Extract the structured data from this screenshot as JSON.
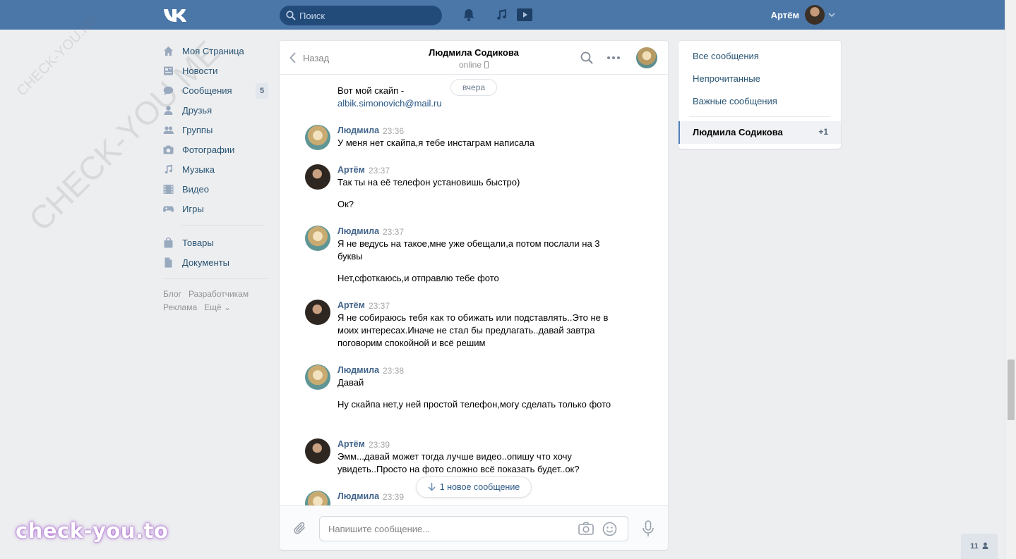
{
  "header": {
    "search_placeholder": "Поиск",
    "user_name": "Артём"
  },
  "sidebar": {
    "items": [
      {
        "label": "Моя Страница",
        "icon": "home-icon"
      },
      {
        "label": "Новости",
        "icon": "news-icon"
      },
      {
        "label": "Сообщения",
        "icon": "messages-icon",
        "badge": "5"
      },
      {
        "label": "Друзья",
        "icon": "friends-icon"
      },
      {
        "label": "Группы",
        "icon": "groups-icon"
      },
      {
        "label": "Фотографии",
        "icon": "camera-icon"
      },
      {
        "label": "Музыка",
        "icon": "music-icon"
      },
      {
        "label": "Видео",
        "icon": "video-icon"
      },
      {
        "label": "Игры",
        "icon": "gamepad-icon"
      }
    ],
    "items2": [
      {
        "label": "Товары",
        "icon": "bag-icon"
      },
      {
        "label": "Документы",
        "icon": "document-icon"
      }
    ],
    "footer": [
      "Блог",
      "Разработчикам",
      "Реклама",
      "Ещё ⌄"
    ]
  },
  "chat": {
    "back_label": "Назад",
    "peer_name": "Людмила Содикова",
    "peer_status": "online",
    "date_separator": "вчера",
    "new_messages_label": "1 новое сообщение",
    "input_placeholder": "Напишите сообщение...",
    "messages": [
      {
        "text_prefix": "Вот мой скайп -",
        "link": "albik.simonovich@mail.ru"
      },
      {
        "author": "Людмила",
        "time": "23:36",
        "text": "У меня нет скайпа,я тебе инстаграм написала"
      },
      {
        "author": "Артём",
        "time": "23:37",
        "text": "Так ты на её телефон установишь быстро)"
      },
      {
        "text": "Ок?"
      },
      {
        "author": "Людмила",
        "time": "23:37",
        "text": "Я не ведусь на такое,мне уже обещали,а потом послали на 3 буквы"
      },
      {
        "text": "Нет,сфоткаюсь,и отправлю тебе фото"
      },
      {
        "author": "Артём",
        "time": "23:37",
        "text": "Я не собираюсь тебя как то обижать или подставлять..Это не в моих интересах.Иначе не стал бы предлагать..давай завтра поговорим спокойной и всё решим"
      },
      {
        "author": "Людмила",
        "time": "23:38",
        "text": "Давай"
      },
      {
        "text": "Ну скайпа нет,у ней простой телефон,могу сделать только фото"
      },
      {
        "author": "Артём",
        "time": "23:39",
        "text": "Эмм...давай может тогда лучше видео..опишу что хочу увидеть..Просто на фото сложно всё показать будет..ок?"
      },
      {
        "author": "Людмила",
        "time": "23:39"
      }
    ]
  },
  "right_panel": {
    "filters": [
      "Все сообщения",
      "Непрочитанные",
      "Важные сообщения"
    ],
    "active_dialog": {
      "name": "Людмила Содикова",
      "count": "+1"
    }
  },
  "online_friends_count": "11",
  "watermarks": {
    "diagonal": "CHECK-YOU.ME",
    "brand": "check-you.to"
  },
  "colors": {
    "header_bg": "#4a76a8",
    "page_bg": "#edeef0",
    "link": "#2a5885",
    "author": "#42648b"
  }
}
